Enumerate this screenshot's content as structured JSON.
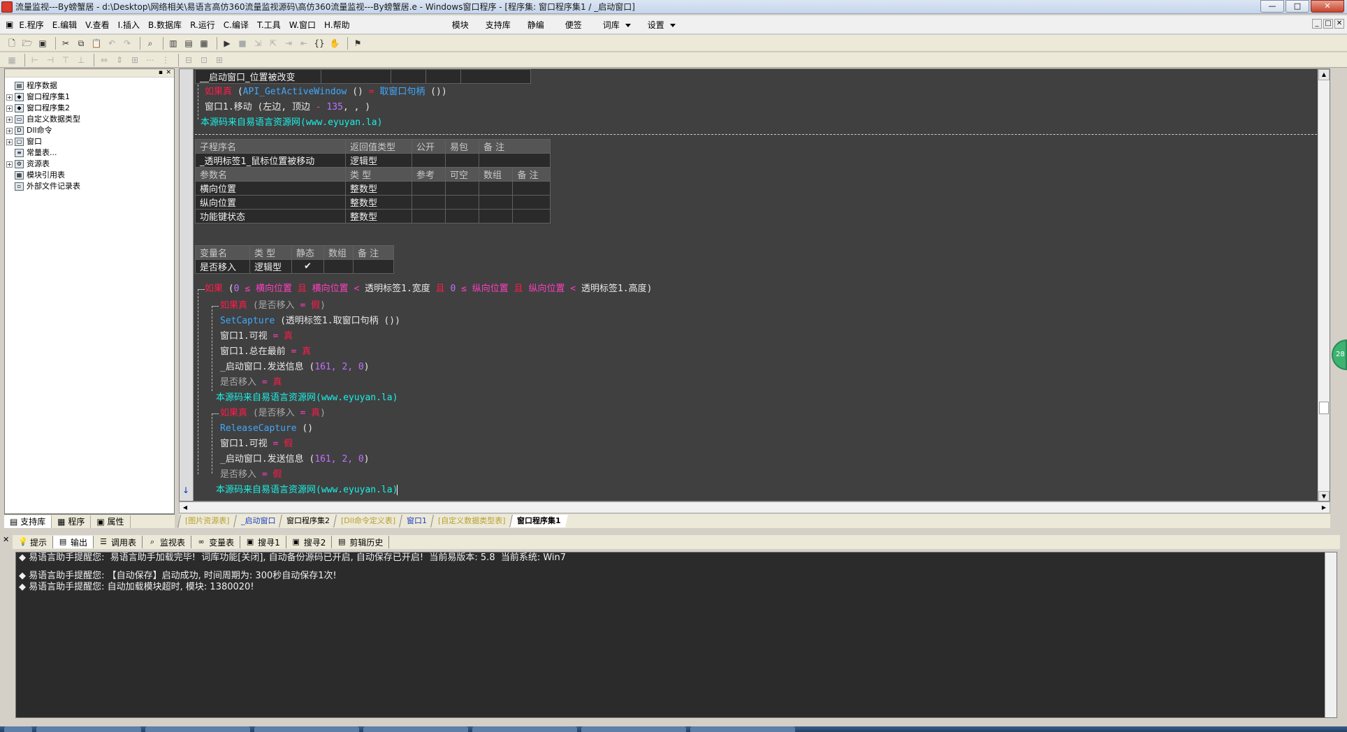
{
  "window": {
    "title": "流量监视---By螃蟹居 - d:\\Desktop\\网络相关\\易语言高仿360流量监视源码\\高仿360流量监视---By螃蟹居.e - Windows窗口程序 - [程序集: 窗口程序集1 / _启动窗口]",
    "btn_minimize": "—",
    "btn_restore": "□",
    "btn_close": "✕"
  },
  "menu": {
    "items": [
      {
        "label": "E.程序"
      },
      {
        "label": "E.编辑"
      },
      {
        "label": "V.查看"
      },
      {
        "label": "I.插入"
      },
      {
        "label": "B.数据库"
      },
      {
        "label": "R.运行"
      },
      {
        "label": "C.编译"
      },
      {
        "label": "T.工具"
      },
      {
        "label": "W.窗口"
      },
      {
        "label": "H.帮助"
      }
    ],
    "extra": [
      {
        "label": "模块"
      },
      {
        "label": "支持库"
      },
      {
        "label": "静编"
      },
      {
        "label": "便签"
      },
      {
        "label": "词库"
      },
      {
        "label": "设置"
      }
    ],
    "mdi": [
      "_",
      "□",
      "✕"
    ]
  },
  "tree": {
    "root": "程序数据",
    "items": [
      {
        "label": "窗口程序集1",
        "expand": "+",
        "icon": "code-icon"
      },
      {
        "label": "窗口程序集2",
        "expand": "+",
        "icon": "code-icon"
      },
      {
        "label": "自定义数据类型",
        "expand": "+",
        "icon": "type-icon"
      },
      {
        "label": "Dll命令",
        "expand": "+",
        "icon": "dll-icon"
      },
      {
        "label": "窗口",
        "expand": "+",
        "icon": "window-icon"
      },
      {
        "label": "常量表...",
        "expand": "",
        "icon": "const-icon"
      },
      {
        "label": "资源表",
        "expand": "+",
        "icon": "resource-icon"
      },
      {
        "label": "模块引用表",
        "expand": "",
        "icon": "module-icon"
      },
      {
        "label": "外部文件记录表",
        "expand": "",
        "icon": "file-icon"
      }
    ]
  },
  "left_tabs": [
    {
      "label": "支持库"
    },
    {
      "label": "程序"
    },
    {
      "label": "属性"
    }
  ],
  "code": {
    "top_row": "__启动窗口_位置被改变",
    "line1": {
      "kw": "如果真",
      "p1": " (",
      "fn1": "API_GetActiveWindow",
      "p2": " () ",
      "op": "=",
      "fn2": " 取窗口句柄",
      "p3": " ())"
    },
    "line2": {
      "a": "窗口1.移动 (左边, 顶边 ",
      "op": "-",
      "num": " 135",
      "b": ", , )"
    },
    "comment": "本源码来自易语言资源网(www.eyuyan.la)",
    "sub_table": {
      "headers": [
        "子程序名",
        "返回值类型",
        "公开",
        "易包",
        "备 注"
      ],
      "row": [
        "_透明标签1_鼠标位置被移动",
        "逻辑型",
        "",
        "",
        ""
      ],
      "param_headers": [
        "参数名",
        "类 型",
        "参考",
        "可空",
        "数组",
        "备 注"
      ],
      "params": [
        [
          "横向位置",
          "整数型",
          "",
          "",
          "",
          ""
        ],
        [
          "纵向位置",
          "整数型",
          "",
          "",
          "",
          ""
        ],
        [
          "功能键状态",
          "整数型",
          "",
          "",
          "",
          ""
        ]
      ]
    },
    "var_table": {
      "headers": [
        "变量名",
        "类 型",
        "静态",
        "数组",
        "备 注"
      ],
      "row": [
        "是否移入",
        "逻辑型",
        "✔",
        "",
        ""
      ]
    },
    "if_line": {
      "kw": "如果",
      "p0": " (",
      "n0": "0",
      "le1": " ≤ ",
      "v1": "横向位置",
      "and1": " 且 ",
      "v2": "横向位置",
      "lt1": " < ",
      "t1": "透明标签1.宽度",
      "and2": " 且 ",
      "n1": "0",
      "le2": " ≤ ",
      "v3": "纵向位置",
      "and3": " 且 ",
      "v4": "纵向位置",
      "lt2": " < ",
      "t2": "透明标签1.高度)"
    },
    "block1": {
      "if": {
        "kw": "如果真",
        "cond": " (是否移入 ",
        "op": "=",
        "val": " 假",
        "end": ")"
      },
      "l1": {
        "fn": "SetCapture",
        "rest": " (透明标签1.取窗口句柄 ())"
      },
      "l2": {
        "a": "窗口1.可视 ",
        "op": "=",
        "v": " 真"
      },
      "l3": {
        "a": "窗口1.总在最前 ",
        "op": "=",
        "v": " 真"
      },
      "l4": {
        "a": "_启动窗口.发送信息 (",
        "n": "161, 2, 0",
        "b": ")"
      },
      "l5": {
        "a": "是否移入 ",
        "op": "=",
        "v": " 真"
      }
    },
    "block2": {
      "if": {
        "kw": "如果真",
        "cond": " (是否移入 ",
        "op": "=",
        "val": " 真",
        "end": ")"
      },
      "l1": {
        "fn": "ReleaseCapture",
        "rest": " ()"
      },
      "l2": {
        "a": "窗口1.可视 ",
        "op": "=",
        "v": " 假"
      },
      "l3": {
        "a": "_启动窗口.发送信息 (",
        "n": "161, 2, 0",
        "b": ")"
      },
      "l4": {
        "a": "是否移入 ",
        "op": "=",
        "v": " 假"
      }
    },
    "side_badge": "28"
  },
  "doc_tabs": [
    {
      "label": "[图片资源表]",
      "kind": "resource"
    },
    {
      "label": "_启动窗口",
      "kind": "window"
    },
    {
      "label": "窗口程序集2",
      "kind": "normal"
    },
    {
      "label": "[Dll命令定义表]",
      "kind": "resource"
    },
    {
      "label": "窗口1",
      "kind": "window"
    },
    {
      "label": "[自定义数据类型表]",
      "kind": "resource"
    },
    {
      "label": "窗口程序集1",
      "kind": "active"
    }
  ],
  "output_tabs": [
    {
      "label": "提示",
      "icon": "hint-icon"
    },
    {
      "label": "输出",
      "icon": "output-icon"
    },
    {
      "label": "调用表",
      "icon": "callstack-icon"
    },
    {
      "label": "监视表",
      "icon": "watch-icon"
    },
    {
      "label": "变量表",
      "icon": "variables-icon"
    },
    {
      "label": "搜寻1",
      "icon": "search1-icon"
    },
    {
      "label": "搜寻2",
      "icon": "search2-icon"
    },
    {
      "label": "剪辑历史",
      "icon": "clip-history-icon"
    }
  ],
  "output": {
    "lines": [
      "◆ 易语言助手提醒您:  易语言助手加载完毕!  词库功能[关闭], 自动备份源码已开启, 自动保存已开启!  当前易版本: 5.8  当前系统: Win7",
      "",
      "◆ 易语言助手提醒您: 【自动保存】启动成功, 时间周期为: 300秒自动保存1次!",
      "◆ 易语言助手提醒您: 自动加载模块超时, 模块: 1380020!"
    ]
  }
}
